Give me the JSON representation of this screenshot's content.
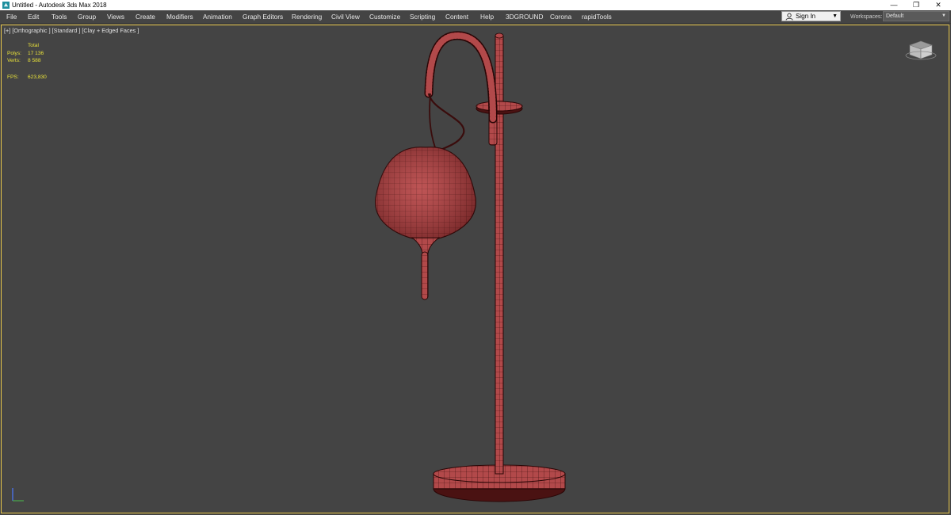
{
  "window": {
    "title": "Untitled - Autodesk 3ds Max 2018",
    "controls": {
      "minimize": "—",
      "restore": "❐",
      "close": "✕"
    }
  },
  "menu": {
    "items": [
      "File",
      "Edit",
      "Tools",
      "Group",
      "Views",
      "Create",
      "Modifiers",
      "Animation",
      "Graph Editors",
      "Rendering",
      "Civil View",
      "Customize",
      "Scripting",
      "Content",
      "Help",
      "3DGROUND",
      "Corona",
      "rapidTools"
    ]
  },
  "account": {
    "sign_in_label": "Sign In"
  },
  "workspaces": {
    "label": "Workspaces:",
    "value": "Default"
  },
  "viewport": {
    "label": "[+] [Orthographic ] [Standard ] [Clay + Edged Faces ]",
    "stats": {
      "header": "Total",
      "polys_label": "Polys:",
      "polys_value": "17 136",
      "verts_label": "Verts:",
      "verts_value": "8 588",
      "fps_label": "FPS:",
      "fps_value": "623,830"
    }
  },
  "colors": {
    "ui_background": "#444444",
    "viewport_border": "#e7c64a",
    "stats_text": "#e9e23a",
    "model_fill": "#b2494a",
    "wire": "#3a0c0c"
  },
  "icons": {
    "app": "3dsmax-logo-icon",
    "user": "user-icon",
    "viewcube": "viewcube-icon",
    "axis": "axis-tripod-icon"
  }
}
